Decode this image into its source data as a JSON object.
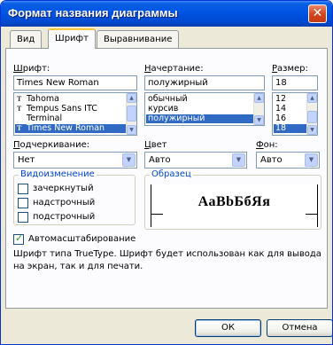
{
  "window": {
    "title": "Формат названия диаграммы",
    "close_symbol": "✕"
  },
  "tabs": [
    {
      "label": "Вид",
      "active": false
    },
    {
      "label": "Шрифт",
      "active": true
    },
    {
      "label": "Выравнивание",
      "active": false
    }
  ],
  "font": {
    "label_accel": "Ш",
    "label_rest": "рифт:",
    "value": "Times New Roman",
    "items": [
      "Tahoma",
      "Tempus Sans ITC",
      "Terminal",
      "Times New Roman"
    ],
    "item_glyphs": [
      "T",
      "T",
      "",
      "T"
    ],
    "selected": "Times New Roman"
  },
  "style": {
    "label_accel": "Н",
    "label_rest": "ачертание:",
    "value": "полужирный",
    "items": [
      "обычный",
      "курсив",
      "полужирный"
    ],
    "selected": "полужирный"
  },
  "size": {
    "label_accel": "Р",
    "label_rest": "азмер:",
    "value": "18",
    "items": [
      "12",
      "14",
      "16",
      "18"
    ],
    "selected": "18"
  },
  "underline": {
    "label_accel": "П",
    "label_rest": "одчеркивание:",
    "value": "Нет"
  },
  "color": {
    "label_accel": "Ц",
    "label_rest": "вет",
    "value": "Авто"
  },
  "background": {
    "label_accel": "Ф",
    "label_rest": "он:",
    "value": "Авто"
  },
  "effects": {
    "title": "Видоизменение",
    "items": [
      {
        "label": "зачеркнутый",
        "accel": "з",
        "checked": false
      },
      {
        "label": "надстрочный",
        "accel": "н",
        "checked": false
      },
      {
        "label": "подстрочный",
        "accel": "о",
        "checked": false
      }
    ]
  },
  "sample": {
    "title": "Образец",
    "text": "АаВbБбЯя"
  },
  "autoscale": {
    "label": "Автомасштабирование",
    "checked": true
  },
  "info_text": "Шрифт типа TrueType. Шрифт будет использован как для вывода на экран, так и для печати.",
  "buttons": {
    "ok": "ОК",
    "cancel": "Отмена"
  }
}
